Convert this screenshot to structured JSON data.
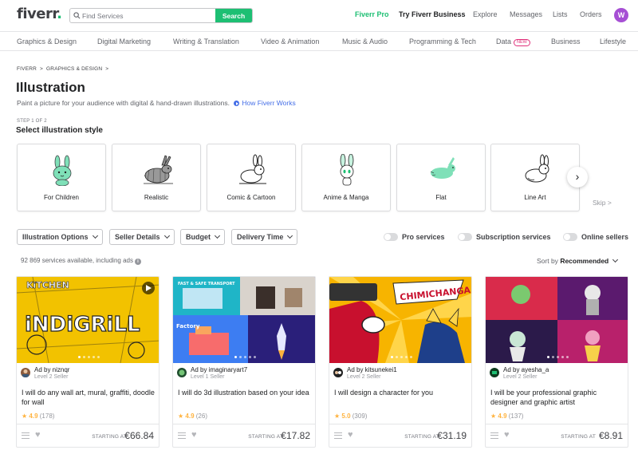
{
  "header": {
    "logo": "fiverr",
    "logo_dot": ".",
    "search_placeholder": "Find Services",
    "search_button": "Search",
    "nav": [
      "Fiverr Pro",
      "Try Fiverr Business",
      "Explore",
      "Messages",
      "Lists",
      "Orders"
    ],
    "avatar_letter": "W"
  },
  "categories": [
    {
      "label": "Graphics & Design"
    },
    {
      "label": "Digital Marketing"
    },
    {
      "label": "Writing & Translation"
    },
    {
      "label": "Video & Animation"
    },
    {
      "label": "Music & Audio"
    },
    {
      "label": "Programming & Tech"
    },
    {
      "label": "Data",
      "badge": "NEW"
    },
    {
      "label": "Business"
    },
    {
      "label": "Lifestyle"
    }
  ],
  "breadcrumb": [
    "FIVERR",
    "GRAPHICS & DESIGN"
  ],
  "breadcrumb_sep": ">",
  "page": {
    "title": "Illustration",
    "subtitle": "Paint a picture for your audience with digital & hand-drawn illustrations.",
    "how_link": "How Fiverr Works",
    "step": "STEP 1 OF 2",
    "select_title": "Select illustration style",
    "skip": "Skip >",
    "next_arrow": "›"
  },
  "styles": [
    {
      "label": "For Children",
      "icon": "rabbit-children-icon",
      "color": "#7fe0b8"
    },
    {
      "label": "Realistic",
      "icon": "rabbit-realistic-icon",
      "color": "#404145"
    },
    {
      "label": "Comic & Cartoon",
      "icon": "rabbit-comic-icon",
      "color": "#ffffff"
    },
    {
      "label": "Anime & Manga",
      "icon": "rabbit-anime-icon",
      "color": "#c7f2df"
    },
    {
      "label": "Flat",
      "icon": "rabbit-flat-icon",
      "color": "#7fe0b8"
    },
    {
      "label": "Line Art",
      "icon": "rabbit-lineart-icon",
      "color": "#ffffff"
    }
  ],
  "filters": {
    "dropdowns": [
      "Illustration Options",
      "Seller Details",
      "Budget",
      "Delivery Time"
    ],
    "toggles": [
      "Pro services",
      "Subscription services",
      "Online sellers"
    ]
  },
  "results": {
    "count_text": "92 869 services available, including ads",
    "info_icon": "i",
    "sort_label": "Sort by",
    "sort_value": "Recommended"
  },
  "gigs": [
    {
      "seller": "Ad by niznqr",
      "level": "Level 2 Seller",
      "title": "I will do any wall art, mural, graffiti, doodle for wall",
      "rating": "4.9",
      "reviews": "(178)",
      "starting": "STARTING AT",
      "price": "€66.84",
      "image_word": "iNDiGRiLL",
      "image_top": "KiTCHEN",
      "theme": "#f2c200"
    },
    {
      "seller": "Ad by imaginaryart7",
      "level": "Level 1 Seller",
      "title": "I will do 3d illustration based on your idea",
      "rating": "4.9",
      "reviews": "(26)",
      "starting": "STARTING AT",
      "price": "€17.82",
      "image_top": "FAST & SAFE TRANSPORT",
      "image_word": "Factory",
      "theme": "#7b5cff"
    },
    {
      "seller": "Ad by kitsunekei1",
      "level": "Level 2 Seller",
      "title": "I will design a character for you",
      "rating": "5.0",
      "reviews": "(309)",
      "starting": "STARTING AT",
      "price": "€31.19",
      "image_word": "CHIMICHANGA!",
      "theme": "#f7b400"
    },
    {
      "seller": "Ad by ayesha_a",
      "level": "Level 2 Seller",
      "title": "I will be your professional graphic designer and graphic artist",
      "rating": "4.9",
      "reviews": "(137)",
      "starting": "STARTING AT",
      "price": "€8.91",
      "theme": "#d92b4b"
    }
  ],
  "colors": {
    "brand_green": "#1dbf73",
    "text_dark": "#222325",
    "star": "#ffb33e",
    "link_blue": "#446ee7"
  }
}
